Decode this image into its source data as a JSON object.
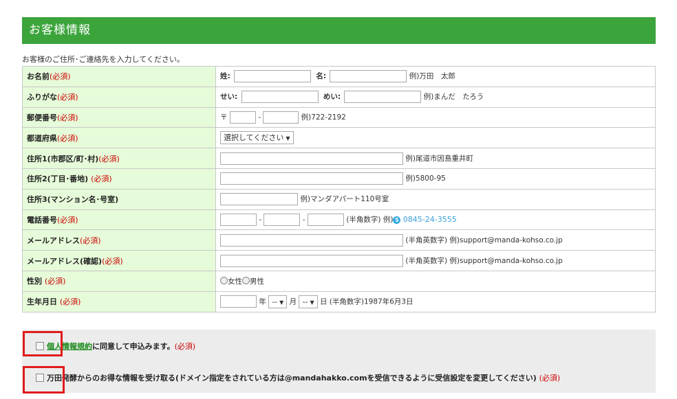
{
  "header": {
    "title": "お客様情報"
  },
  "intro": "お客様のご住所･ご連絡先を入力してください。",
  "required_mark": "(必須)",
  "rows": {
    "name": {
      "label": "お名前",
      "sei_label": "姓:",
      "mei_label": "名:",
      "example": "例)万田　太郎"
    },
    "furigana": {
      "label": "ふりがな",
      "sei_label": "せい:",
      "mei_label": "めい:",
      "example": "例)まんだ　たろう"
    },
    "postal": {
      "label": "郵便番号",
      "prefix": "〒",
      "sep": "-",
      "example": "例)722-2192"
    },
    "prefecture": {
      "label": "都道府県",
      "select_value": "選択してください"
    },
    "address1": {
      "label": "住所1(市郡区/町･村)",
      "example": "例)尾道市因島重井町"
    },
    "address2": {
      "label": "住所2(丁目･番地)",
      "example": "例)5800-95"
    },
    "address3": {
      "label": "住所3(マンション名･号室)",
      "example": "例)マンダアパート110号室"
    },
    "phone": {
      "label": "電話番号",
      "sep": "-",
      "note": "(半角数字) 例)",
      "example_number": "0845-24-3555",
      "icon": "skype-icon"
    },
    "email": {
      "label": "メールアドレス",
      "example": "(半角英数字) 例)support@manda-kohso.co.jp"
    },
    "email_confirm": {
      "label": "メールアドレス(確認)",
      "example": "(半角英数字) 例)support@manda-kohso.co.jp"
    },
    "gender": {
      "label": "性別",
      "female": "女性",
      "male": "男性"
    },
    "birthday": {
      "label": "生年月日",
      "year_label": "年",
      "month_value": "--",
      "month_label": "月",
      "day_value": "--",
      "day_label": "日",
      "example": "(半角数字)1987年6月3日"
    }
  },
  "agreements": {
    "privacy_link": "個人情報規約",
    "privacy_text": "に同意して申込みます。",
    "newsletter_text": "万田発酵からのお得な情報を受け取る(ドメイン指定をされている方は@mandahakko.comを受信できるように受信設定を変更してください)"
  },
  "colors": {
    "header_bg": "#3ba43b",
    "label_bg": "#e6fbd9",
    "required": "#cc0000",
    "highlight": "#e01b1b"
  }
}
